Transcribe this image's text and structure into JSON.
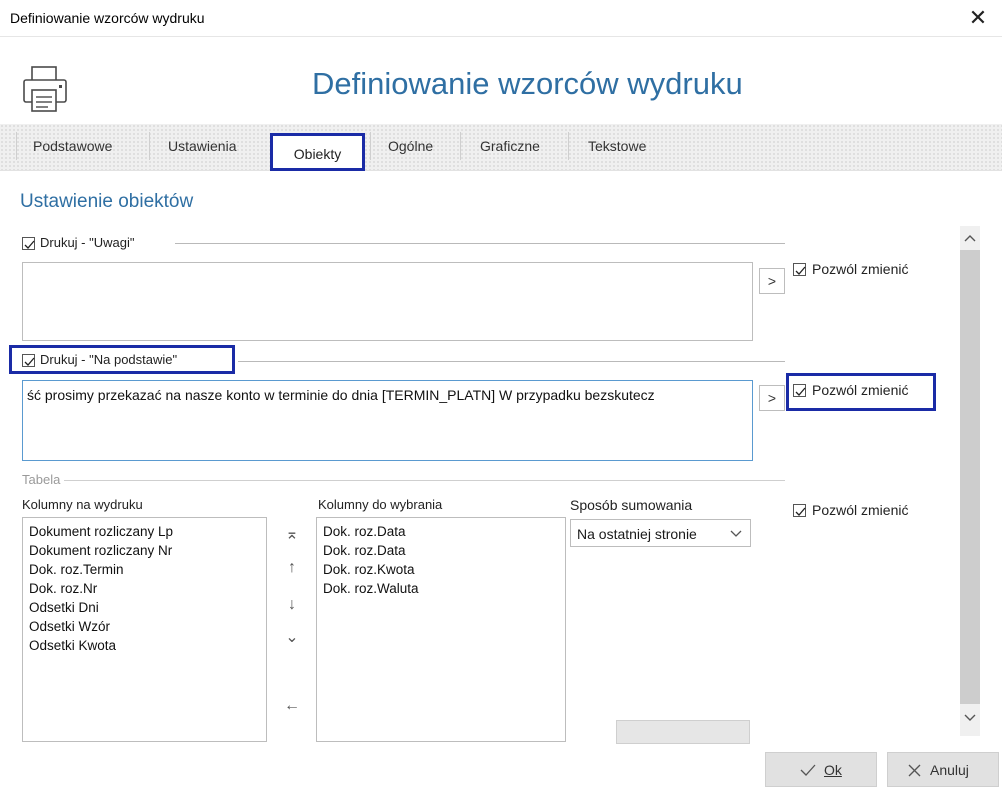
{
  "window": {
    "title": "Definiowanie wzorców wydruku",
    "close_glyph": "✕"
  },
  "header": {
    "title": "Definiowanie wzorców wydruku",
    "icon": "printer-icon"
  },
  "tabs": [
    {
      "label": "Podstawowe"
    },
    {
      "label": "Ustawienia"
    },
    {
      "label": "Obiekty",
      "active": true
    },
    {
      "label": "Ogólne"
    },
    {
      "label": "Graficzne"
    },
    {
      "label": "Tekstowe"
    }
  ],
  "section": {
    "title": "Ustawienie obiektów"
  },
  "uwagi": {
    "checkbox_label": "Drukuj - \"Uwagi\"",
    "checked": true,
    "text": "",
    "expand_glyph": ">",
    "allow_change_label": "Pozwól zmienić",
    "allow_change_checked": true
  },
  "na_podstawie": {
    "checkbox_label": "Drukuj - \"Na podstawie\"",
    "checked": true,
    "text": "ść prosimy przekazać na nasze konto w terminie do dnia [TERMIN_PLATN] W przypadku bezskutecz",
    "expand_glyph": ">",
    "allow_change_label": "Pozwól zmienić",
    "allow_change_checked": true
  },
  "tabela": {
    "group_label": "Tabela",
    "columns_on_print_label": "Kolumny na wydruku",
    "columns_on_print": [
      "Dokument rozliczany Lp",
      "Dokument rozliczany Nr",
      "Dok. roz.Termin",
      "Dok. roz.Nr",
      "Odsetki Dni",
      "Odsetki Wzór",
      "Odsetki Kwota"
    ],
    "columns_available_label": "Kolumny do wybrania",
    "columns_available": [
      "Dok. roz.Data",
      "Dok. roz.Data",
      "Dok. roz.Kwota",
      "Dok. roz.Waluta"
    ],
    "summing_label": "Sposób sumowania",
    "summing_value": "Na ostatniej stronie",
    "allow_change_label": "Pozwól zmienić",
    "allow_change_checked": true,
    "move_buttons": {
      "top": "⌅",
      "up": "↑",
      "down": "↓",
      "bottom": "⌄",
      "left": "←"
    }
  },
  "buttons": {
    "ok_label": "Ok",
    "cancel_label": "Anuluj"
  },
  "colors": {
    "accent": "#2f6fa3",
    "highlight": "#1a2ba6"
  }
}
